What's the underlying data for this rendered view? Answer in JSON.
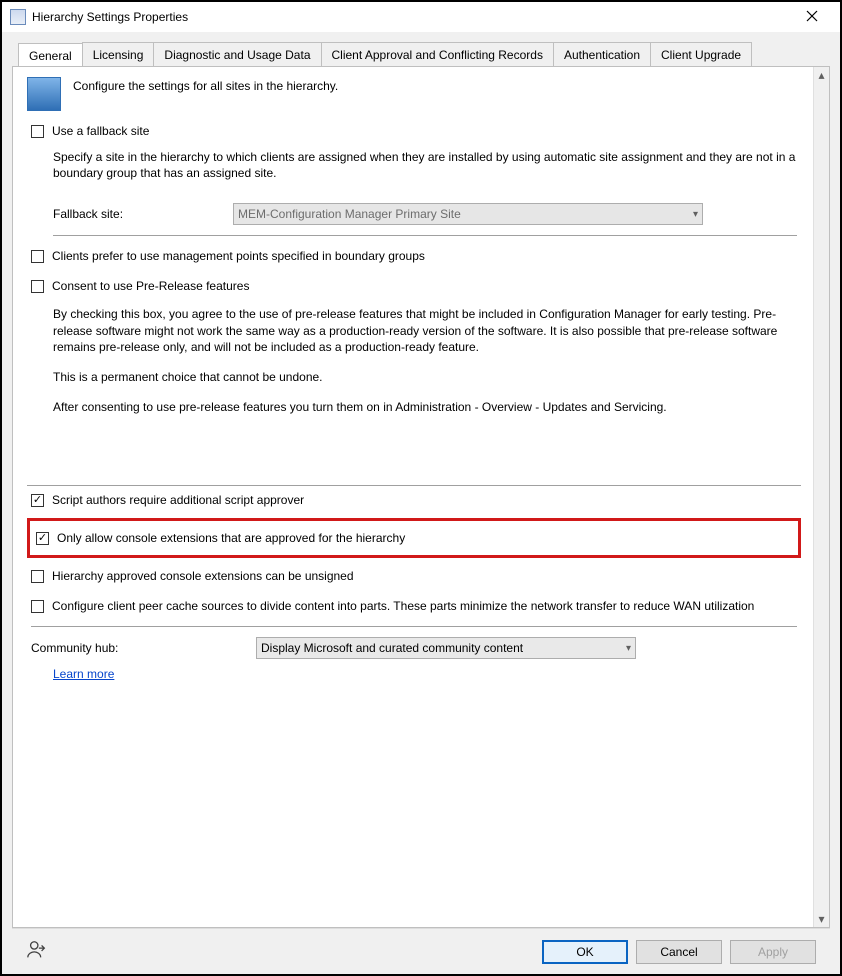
{
  "window": {
    "title": "Hierarchy Settings Properties"
  },
  "tabs": [
    "General",
    "Licensing",
    "Diagnostic and Usage Data",
    "Client Approval and Conflicting Records",
    "Authentication",
    "Client Upgrade"
  ],
  "intro": "Configure the settings for all sites in the hierarchy.",
  "fallback": {
    "checkbox": "Use a fallback site",
    "desc": "Specify a site in the hierarchy to which clients are assigned when they are installed by using automatic site assignment and they are not in a boundary group that has an assigned site.",
    "label": "Fallback site:",
    "value": "MEM-Configuration Manager Primary Site"
  },
  "boundary_checkbox": "Clients prefer to use management points specified in boundary groups",
  "prerelease": {
    "checkbox": "Consent to use Pre-Release features",
    "p1": "By checking this box, you agree to the use of pre-release features that might be included in Configuration Manager for early testing. Pre-release software might not work the same way as a production-ready version of the software. It is also possible that pre-release software remains pre-release only, and will not be included as a production-ready feature.",
    "p2": "This is a permanent choice that cannot be undone.",
    "p3": "After consenting to use pre-release features you turn them on in Administration - Overview - Updates and Servicing."
  },
  "script_approver": "Script authors require additional script approver",
  "approved_ext": "Only allow console extensions that are approved for the hierarchy",
  "unsigned_ext": "Hierarchy approved console extensions can be unsigned",
  "peer_cache": "Configure client peer cache sources to divide content into parts. These parts minimize the network transfer to reduce WAN utilization",
  "community": {
    "label": "Community hub:",
    "value": "Display Microsoft and curated community content",
    "link": "Learn more"
  },
  "buttons": {
    "ok": "OK",
    "cancel": "Cancel",
    "apply": "Apply"
  }
}
